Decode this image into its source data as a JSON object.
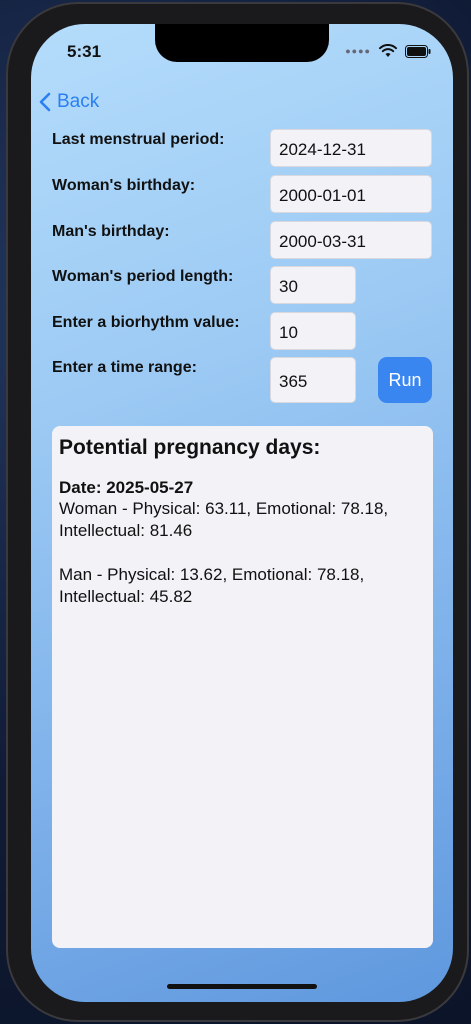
{
  "status_bar": {
    "time": "5:31"
  },
  "nav": {
    "back_label": "Back"
  },
  "form": {
    "last_period_label": "Last menstrual period:",
    "last_period_value": "2024-12-31",
    "woman_birthday_label": "Woman's birthday:",
    "woman_birthday_value": "2000-01-01",
    "man_birthday_label": "Man's birthday:",
    "man_birthday_value": "2000-03-31",
    "period_length_label": "Woman's period length:",
    "period_length_value": "30",
    "biorhythm_label": "Enter a biorhythm value:",
    "biorhythm_value": "10",
    "time_range_label": "Enter a time range:",
    "time_range_value": "365",
    "run_label": "Run"
  },
  "results": {
    "title": "Potential pregnancy days:",
    "date": "Date: 2025-05-27",
    "woman_line1": "Woman - Physical: 63.11, Emotional: 78.18,",
    "woman_line2": "Intellectual: 81.46",
    "man_line1": "Man - Physical: 13.62, Emotional: 78.18,",
    "man_line2": "Intellectual: 45.82"
  },
  "colors": {
    "accent": "#3a86f1",
    "back_link": "#2a7ff2",
    "field_bg": "#f2f2f7"
  }
}
